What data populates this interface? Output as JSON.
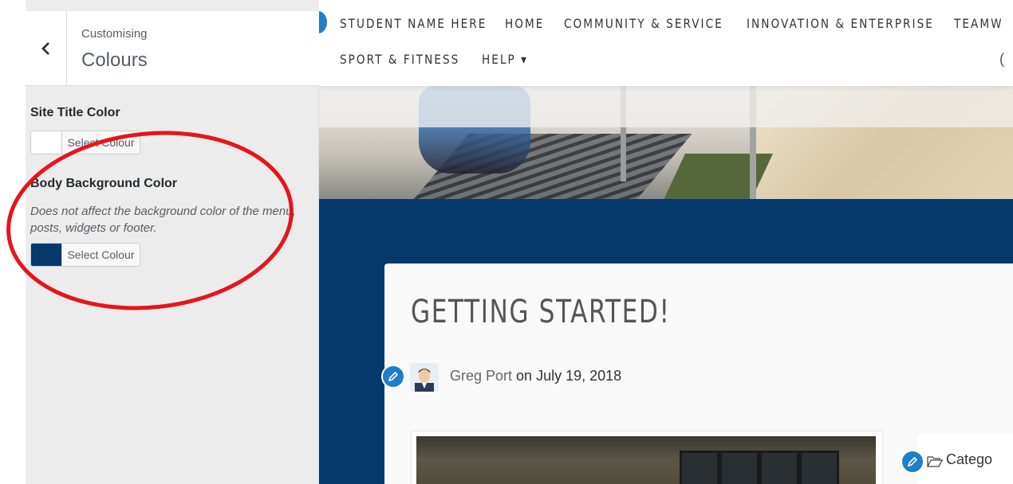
{
  "customizer": {
    "breadcrumb": "Customising",
    "title": "Colours",
    "site_title_color": {
      "label": "Site Title Color",
      "button_label": "Select Colour",
      "swatch_color": "#ffffff"
    },
    "body_background_color": {
      "label": "Body Background Color",
      "description": "Does not affect the background color of the menu, posts, widgets or footer.",
      "button_label": "Select Colour",
      "swatch_color": "#06396b"
    }
  },
  "preview": {
    "nav": {
      "items_row1": [
        "STUDENT NAME HERE",
        "HOME",
        "COMMUNITY & SERVICE",
        "INNOVATION & ENTERPRISE",
        "TEAMW"
      ],
      "items_row2": [
        "SPORT & FITNESS",
        "HELP ▾"
      ],
      "right_glyph": "("
    },
    "post": {
      "title": "GETTING STARTED!",
      "author": "Greg Port",
      "date_text": "on July 19, 2018"
    },
    "category_label": "Catego"
  },
  "colors": {
    "annotation": "#e8141b",
    "body_background": "#06396b",
    "edit_shortcut": "#1e7ec8"
  }
}
